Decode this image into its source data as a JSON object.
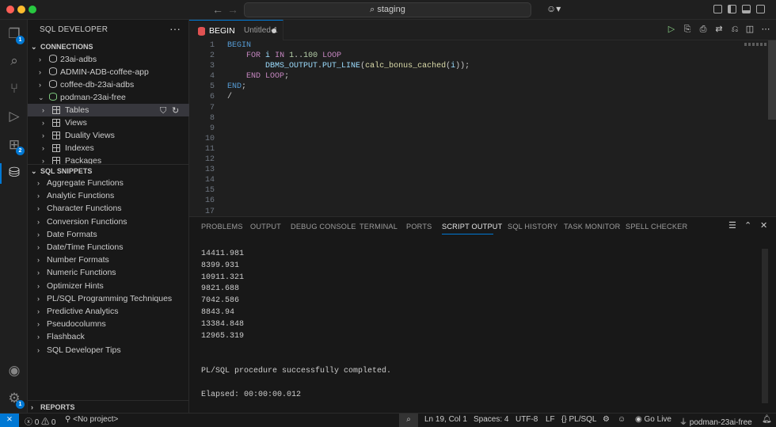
{
  "window": {
    "search_text": "staging"
  },
  "activity_bar": {
    "explorer_badge": "1",
    "extensions_badge": "2",
    "manage_badge": "1"
  },
  "sidebar": {
    "title": "SQL DEVELOPER",
    "more": "···",
    "connections_header": "CONNECTIONS",
    "connections": [
      {
        "label": "23ai-adbs"
      },
      {
        "label": "ADMIN-ADB-coffee-app"
      },
      {
        "label": "coffee-db-23ai-adbs"
      },
      {
        "label": "podman-23ai-free"
      }
    ],
    "children": [
      {
        "label": "Tables"
      },
      {
        "label": "Views"
      },
      {
        "label": "Duality Views"
      },
      {
        "label": "Indexes"
      },
      {
        "label": "Packages"
      }
    ],
    "snippets_header": "SQL SNIPPETS",
    "snippets": [
      "Aggregate Functions",
      "Analytic Functions",
      "Character Functions",
      "Conversion Functions",
      "Date Formats",
      "Date/Time Functions",
      "Number Formats",
      "Numeric Functions",
      "Optimizer Hints",
      "PL/SQL Programming Techniques",
      "Predictive Analytics",
      "Pseudocolumns",
      "Flashback",
      "SQL Developer Tips"
    ],
    "reports_header": "REPORTS"
  },
  "editor": {
    "tab_name": "BEGIN",
    "tab_file": "Untitled-1",
    "line_numbers": [
      "1",
      "2",
      "3",
      "4",
      "5",
      "6",
      "7",
      "8",
      "9",
      "10",
      "11",
      "12",
      "13",
      "14",
      "15",
      "16",
      "17"
    ]
  },
  "panel": {
    "tabs": [
      "PROBLEMS",
      "OUTPUT",
      "DEBUG CONSOLE",
      "TERMINAL",
      "PORTS",
      "SCRIPT OUTPUT",
      "SQL HISTORY",
      "TASK MONITOR",
      "SPELL CHECKER"
    ],
    "active_tab": "SCRIPT OUTPUT",
    "output_lines": [
      "14411.981",
      "8399.931",
      "10911.321",
      "9821.688",
      "7042.586",
      "8843.94",
      "13384.848",
      "12965.319",
      "",
      "",
      "PL/SQL procedure successfully completed.",
      "",
      "Elapsed: 00:00:00.012"
    ]
  },
  "statusbar": {
    "errors": "0",
    "warnings": "0",
    "project": "<No project>",
    "cursor": "Ln 19, Col 1",
    "spaces": "Spaces: 4",
    "encoding": "UTF-8",
    "eol": "LF",
    "language": "PL/SQL",
    "golive": "Go Live",
    "connection": "podman-23ai-free"
  },
  "colors": {
    "accent": "#0078d4",
    "tab_icon": "#e05252"
  }
}
